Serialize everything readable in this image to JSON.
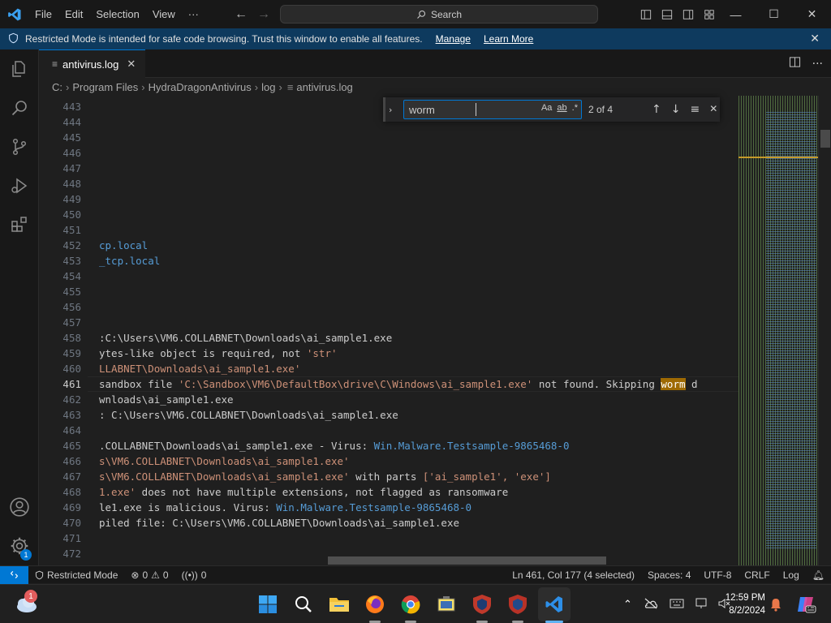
{
  "titlebar": {
    "menu": [
      "File",
      "Edit",
      "Selection",
      "View",
      "···"
    ],
    "search_label": "Search",
    "window_controls": {
      "minimize": "—",
      "maximize": "☐",
      "close": "✕"
    }
  },
  "banner": {
    "text": "Restricted Mode is intended for safe code browsing. Trust this window to enable all features.",
    "manage": "Manage",
    "learn_more": "Learn More"
  },
  "tab": {
    "label": "antivirus.log",
    "close": "✕"
  },
  "breadcrumb": {
    "items": [
      "C:",
      "Program Files",
      "HydraDragonAntivirus",
      "log",
      "antivirus.log"
    ]
  },
  "find": {
    "value": "worm",
    "match_case": "Aa",
    "whole_word": "ab",
    "regex": ".*",
    "count": "2 of 4"
  },
  "editor": {
    "line_numbers": [
      "443",
      "444",
      "445",
      "446",
      "447",
      "448",
      "449",
      "450",
      "451",
      "452",
      "453",
      "454",
      "455",
      "456",
      "457",
      "458",
      "459",
      "460",
      "461",
      "462",
      "463",
      "464",
      "465",
      "466",
      "467",
      "468",
      "469",
      "470",
      "471",
      "472"
    ],
    "active_line": "461",
    "lines": {
      "l452": "cp.local",
      "l453": "_tcp.local",
      "l458": ":C:\\Users\\VM6.COLLABNET\\Downloads\\ai_sample1.exe",
      "l459a": "ytes-like object is required, not ",
      "l459b": "'str'",
      "l460": "LLABNET\\Downloads\\ai_sample1.exe'",
      "l461a": "sandbox file ",
      "l461b": "'C:\\Sandbox\\VM6\\DefaultBox\\drive\\C\\Windows\\ai_sample1.exe'",
      "l461c": " not found. Skipping ",
      "l461d": "worm",
      "l461e": " d",
      "l462": "wnloads\\ai_sample1.exe",
      "l463": ": C:\\Users\\VM6.COLLABNET\\Downloads\\ai_sample1.exe",
      "l465a": ".COLLABNET\\Downloads\\ai_sample1.exe - Virus: ",
      "l465b": "Win.Malware.Testsample-9865468-0",
      "l466": "s\\VM6.COLLABNET\\Downloads\\ai_sample1.exe'",
      "l467a": "s\\VM6.COLLABNET\\Downloads\\ai_sample1.exe'",
      "l467b": " with parts ",
      "l467c": "['ai_sample1', 'exe']",
      "l468a": "1.exe'",
      "l468b": " does not have multiple extensions, not flagged as ransomware",
      "l469a": "le1.exe is malicious. Virus: ",
      "l469b": "Win.Malware.Testsample-9865468-0",
      "l470": "piled file: C:\\Users\\VM6.COLLABNET\\Downloads\\ai_sample1.exe"
    }
  },
  "statusbar": {
    "restricted": "Restricted Mode",
    "errors": "0",
    "warnings": "0",
    "ports": "0",
    "position": "Ln 461, Col 177 (4 selected)",
    "spaces": "Spaces: 4",
    "encoding": "UTF-8",
    "eol": "CRLF",
    "language": "Log"
  },
  "accounts_badge": "1",
  "taskbar": {
    "weather_badge": "1",
    "time": "12:59 PM",
    "date": "8/2/2024"
  },
  "colors": {
    "accent": "#0078d4",
    "banner_bg": "#0e3a5e",
    "string": "#ce9178",
    "link": "#569cd6",
    "find_highlight": "#9e6a03"
  }
}
